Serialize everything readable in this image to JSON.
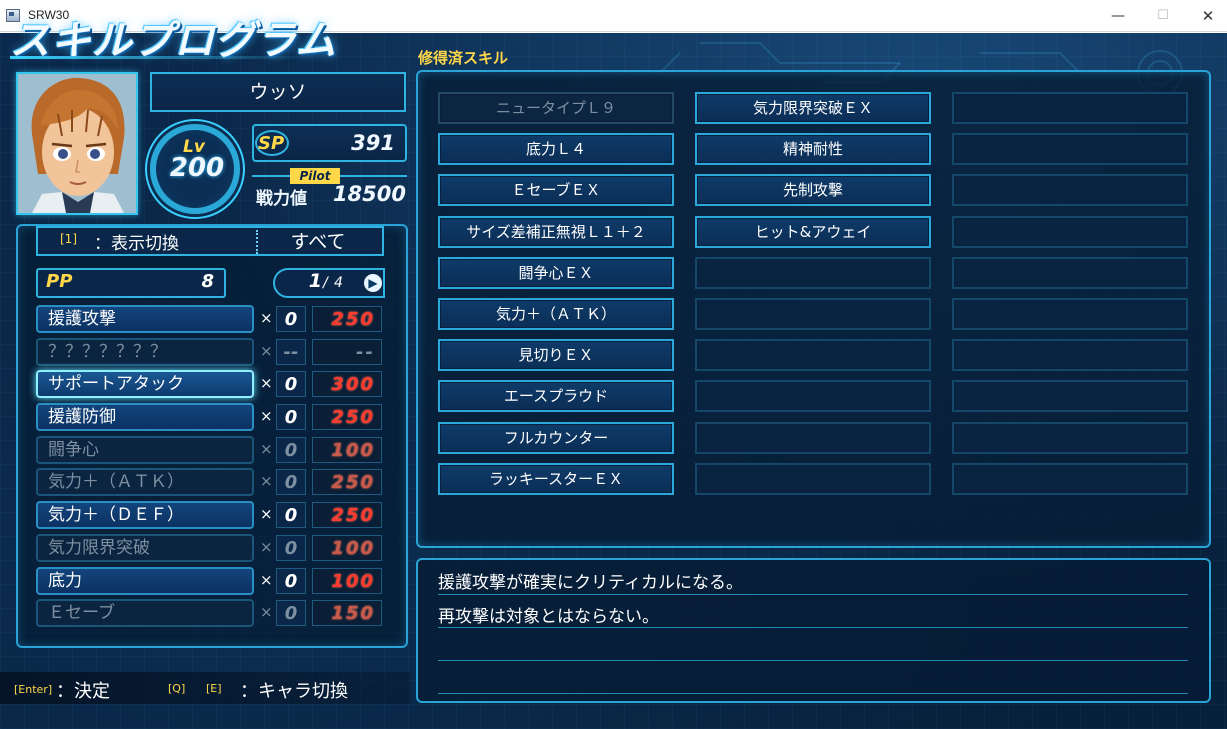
{
  "window": {
    "title": "SRW30",
    "minimize": "—",
    "maximize": "☐",
    "close": "✕"
  },
  "screen_title": "スキルプログラム",
  "pilot": {
    "name": "ウッソ",
    "lv_label": "Lv",
    "level": "200",
    "sp_label": "SP",
    "sp": "391",
    "pilot_tag": "Pilot",
    "power_label": "戦力値",
    "power": "18500"
  },
  "filter": {
    "key": "[1]",
    "label": "：表示切換",
    "value": "すべて"
  },
  "pp": {
    "label": "PP",
    "value": "8"
  },
  "page": {
    "current": "1",
    "slash": "/",
    "total": "4",
    "next": "▶"
  },
  "programs": [
    {
      "name": "援護攻撃",
      "x": "×",
      "count": "0",
      "cost": "250",
      "state": "normal"
    },
    {
      "name": "？？？？？？？",
      "x": "×",
      "count": "--",
      "cost": "--",
      "state": "locked"
    },
    {
      "name": "サポートアタック",
      "x": "×",
      "count": "0",
      "cost": "300",
      "state": "selected"
    },
    {
      "name": "援護防御",
      "x": "×",
      "count": "0",
      "cost": "250",
      "state": "normal"
    },
    {
      "name": "闘争心",
      "x": "×",
      "count": "0",
      "cost": "100",
      "state": "dim"
    },
    {
      "name": "気力＋（ＡＴＫ）",
      "x": "×",
      "count": "0",
      "cost": "250",
      "state": "dim"
    },
    {
      "name": "気力＋（ＤＥＦ）",
      "x": "×",
      "count": "0",
      "cost": "250",
      "state": "normal"
    },
    {
      "name": "気力限界突破",
      "x": "×",
      "count": "0",
      "cost": "100",
      "state": "dim"
    },
    {
      "name": "底力",
      "x": "×",
      "count": "0",
      "cost": "100",
      "state": "normal"
    },
    {
      "name": "Ｅセーブ",
      "x": "×",
      "count": "0",
      "cost": "150",
      "state": "dim"
    }
  ],
  "learned": {
    "title": "修得済スキル",
    "columns": [
      [
        "ニュータイプＬ９",
        "底力Ｌ４",
        "ＥセーブＥＸ",
        "サイズ差補正無視Ｌ１＋２",
        "闘争心ＥＸ",
        "気力＋（ＡＴＫ）",
        "見切りＥＸ",
        "エースプラウド",
        "フルカウンター",
        "ラッキースターＥＸ"
      ],
      [
        "気力限界突破ＥＸ",
        "精神耐性",
        "先制攻撃",
        "ヒット&アウェイ",
        "",
        "",
        "",
        "",
        "",
        ""
      ],
      [
        "",
        "",
        "",
        "",
        "",
        "",
        "",
        "",
        "",
        ""
      ]
    ]
  },
  "description": [
    "援護攻撃が確実にクリティカルになる。",
    "再攻撃は対象とはならない。"
  ],
  "footer": {
    "enter_key": "[Enter]",
    "enter_text": "：決定",
    "q_key": "[Q]",
    "e_key": "[E]",
    "switch_text": "：キャラ切換"
  }
}
